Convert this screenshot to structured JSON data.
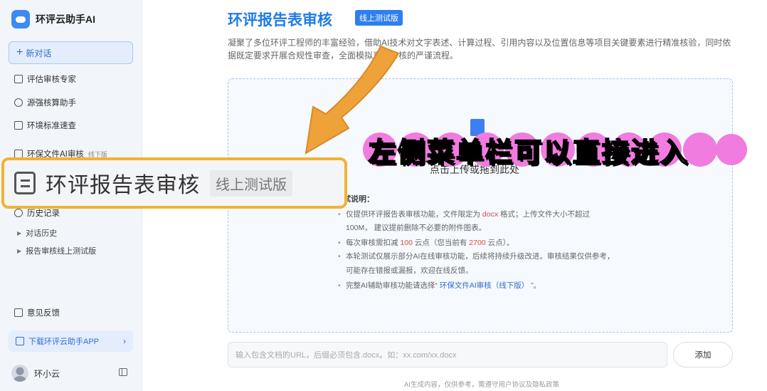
{
  "app": {
    "name": "环评云助手AI",
    "new_chat": "新对话"
  },
  "sidebar": {
    "items": [
      {
        "label": "评估审核专家"
      },
      {
        "label": "源强核算助手"
      },
      {
        "label": "环境标准速查"
      },
      {
        "label": "环保文件AI审核",
        "tag": "线下版"
      },
      {
        "label": "历史记录"
      }
    ],
    "history": [
      "对话历史",
      "报告审核线上测试版"
    ],
    "feedback": "意见反馈",
    "download": "下载环评云助手APP",
    "user_name": "环小云"
  },
  "main": {
    "title": "环评报告表审核",
    "title_tag": "线上测试版",
    "description": "凝聚了多位环评工程师的丰富经验，借助AI技术对文字表述、计算过程、引用内容以及位置信息等项目关键要素进行精准核验，同时依据既定要求开展合规性审查，全面模拟真人审核的严谨流程。",
    "upload_text": "点击上传或拖到此处",
    "notes_title": "试说明：",
    "notes": [
      {
        "a": "仅提供环评报告表审核功能，文件限定为 ",
        "em": "docx",
        "b": " 格式；上传文件大小不超过"
      },
      {
        "a": "100M， 建议提前删除不必要的附件图表。"
      },
      {
        "a": "每次审核需扣减 ",
        "em": "100",
        "b": " 云点（您当前有 ",
        "em2": "2700",
        "c": " 云点）。"
      },
      {
        "a": "本轮测试仅展示部分AI在线审核功能，后续将持续升级改进。审核结果仅供参考，"
      },
      {
        "a": "可能存在错报或漏报，欢迎在线反馈。"
      },
      {
        "a": "完整AI辅助审核功能请选择“ ",
        "link": "环保文件AI审核（线下版）",
        "b": " ”。"
      }
    ],
    "url_placeholder": "输入包含文档的URL，后缀必须包含.docx。如：xx.com/xx.docx",
    "add_button": "添加",
    "footer": "AI生成内容，仅供参考，需遵守用户协议及隐私政策"
  },
  "overlay": {
    "callout": "左侧菜单栏可以直接进入",
    "zoom_title": "环评报告表审核",
    "zoom_tag": "线上测试版"
  },
  "colors": {
    "accent": "#1f7be8",
    "highlight_border": "#f2b233",
    "arrow": "#f0a23a",
    "callout_circles": "#f07ce0"
  }
}
